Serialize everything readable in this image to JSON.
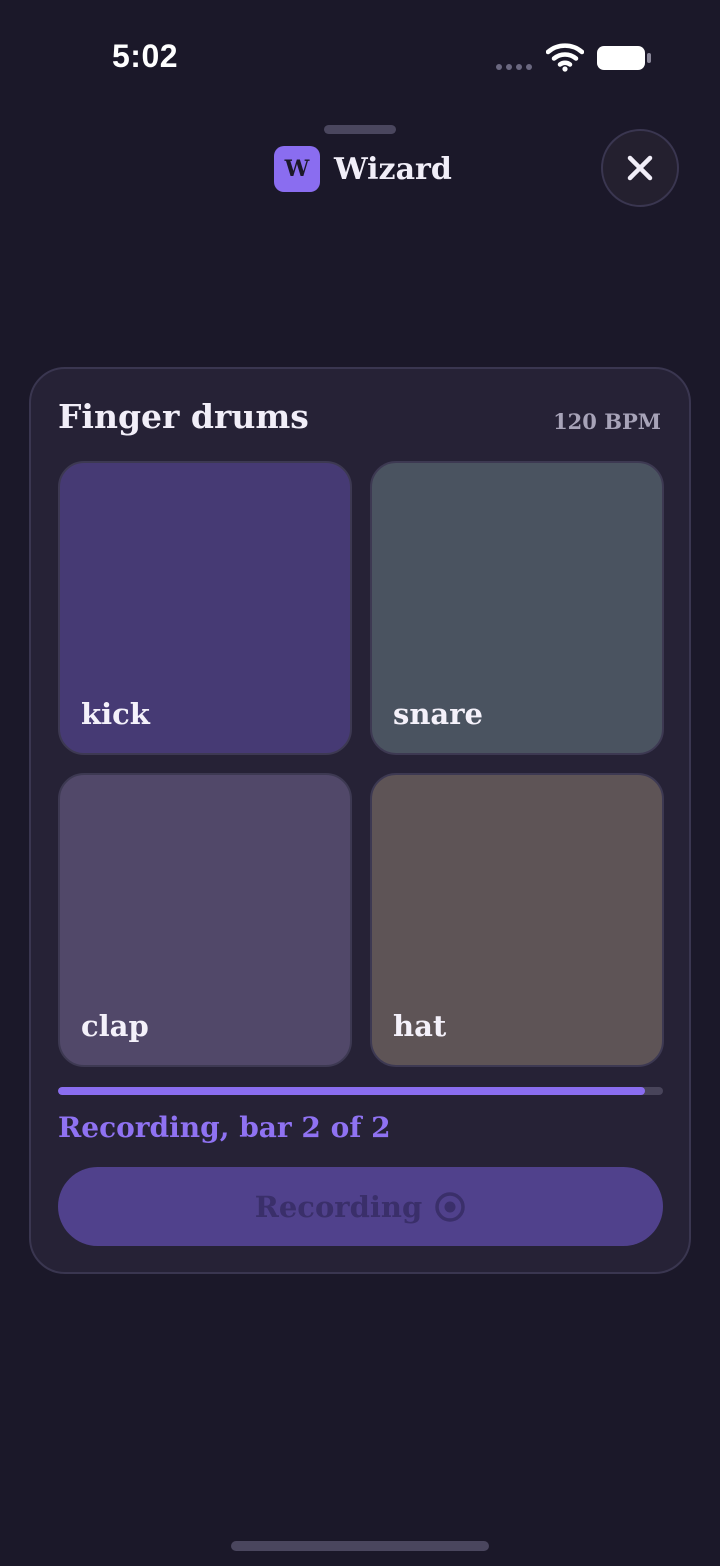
{
  "status_bar": {
    "time": "5:02"
  },
  "header": {
    "logo_letter": "W",
    "title": "Wizard",
    "close_icon": "close-icon"
  },
  "card": {
    "title": "Finger drums",
    "bpm": "120 BPM",
    "pads": [
      {
        "label": "kick",
        "color": "#463a74"
      },
      {
        "label": "snare",
        "color": "#4a5360"
      },
      {
        "label": "clap",
        "color": "#514869"
      },
      {
        "label": "hat",
        "color": "#5e5456"
      }
    ],
    "progress": 0.97,
    "status_text": "Recording, bar 2 of 2",
    "record_button": {
      "label": "Recording",
      "icon": "record-icon"
    }
  },
  "colors": {
    "background": "#1b1829",
    "accent": "#8a6df0",
    "card": "#262236"
  }
}
